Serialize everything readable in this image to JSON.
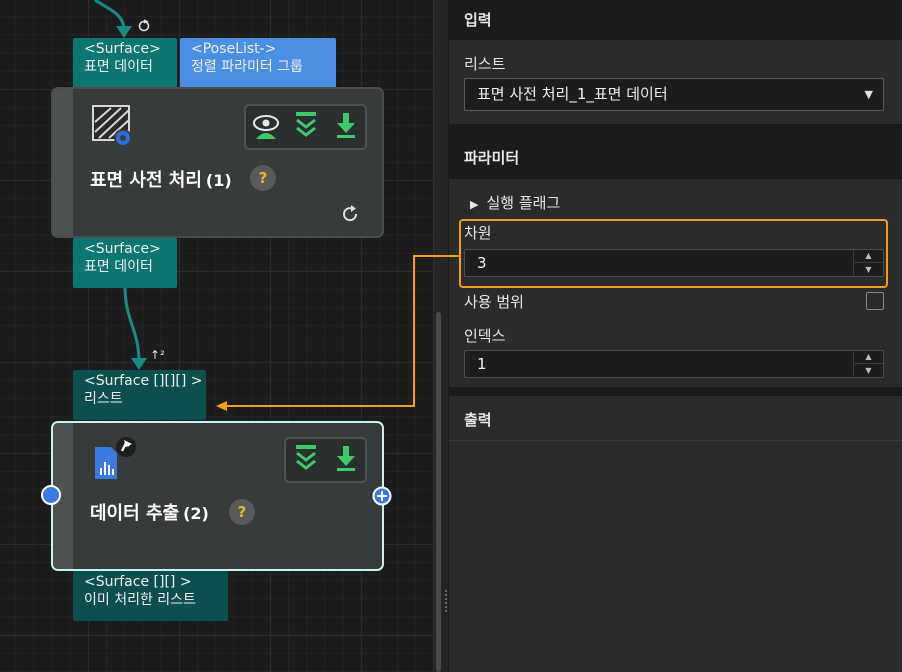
{
  "canvas": {
    "node1": {
      "in_ports": [
        {
          "type": "<Surface>",
          "label": "표면 데이터"
        },
        {
          "type": "<PoseList->",
          "label": "정렬 파라미터 그룹"
        }
      ],
      "title": "표면 사전 처리",
      "index": "(1)",
      "help": "?",
      "out_port": {
        "type": "<Surface>",
        "label": "표면 데이터"
      }
    },
    "node2": {
      "in_port": {
        "type": "<Surface [][][] >",
        "label": "리스트"
      },
      "dimension_badge": "↑²",
      "title": "데이터 추출",
      "index": "(2)",
      "help": "?",
      "out_port": {
        "type": "<Surface [][] >",
        "label": "이미 처리한 리스트"
      }
    }
  },
  "panel": {
    "input_section": {
      "title": "입력",
      "list_label": "리스트",
      "list_value": "표면 사전 처리_1_표면 데이터"
    },
    "params_section": {
      "title": "파라미터",
      "run_flags": "실행 플래그",
      "dimension_label": "차원",
      "dimension_value": "3",
      "use_range_label": "사용 범위",
      "use_range_checked": false,
      "index_label": "인덱스",
      "index_value": "1"
    },
    "output_section": {
      "title": "출력"
    }
  },
  "colors": {
    "highlight": "#f39c1f",
    "port_teal": "#0b7672",
    "port_blue": "#4a8fe3",
    "edge": "#1a8a86",
    "accent_green": "#3ec96b"
  }
}
